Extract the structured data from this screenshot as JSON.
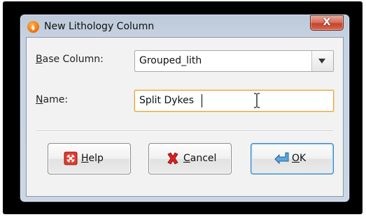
{
  "window": {
    "title": "New Lithology Column",
    "close_label": "X"
  },
  "form": {
    "base_column": {
      "label_mnemonic": "B",
      "label_rest": "ase Column:",
      "value": "Grouped_lith"
    },
    "name": {
      "label_mnemonic": "N",
      "label_rest": "ame:",
      "value": "Split Dykes"
    }
  },
  "buttons": {
    "help": {
      "mnemonic": "H",
      "rest": "elp"
    },
    "cancel": {
      "mnemonic": "C",
      "rest": "ancel"
    },
    "ok": {
      "mnemonic": "O",
      "rest": "K"
    }
  },
  "colors": {
    "focus_border": "#e8a13c",
    "close_button": "#c2442a",
    "ok_button_border": "#3c7fb1"
  },
  "icons": {
    "app": "lithology-app-icon",
    "help": "lifebuoy-icon",
    "cancel": "red-x-icon",
    "ok": "return-arrow-icon"
  }
}
